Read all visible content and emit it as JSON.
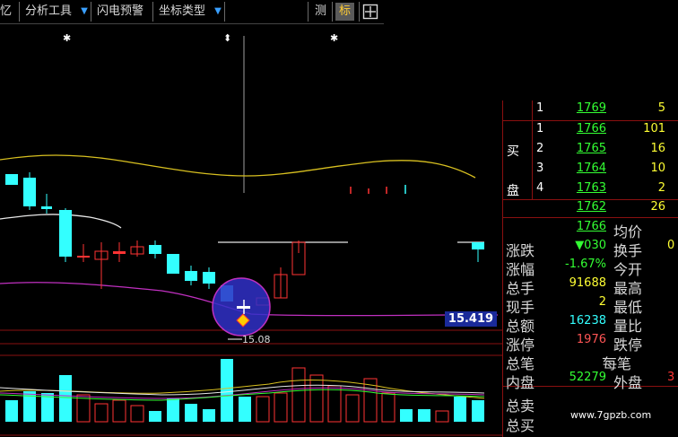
{
  "toolbar": {
    "items": [
      "忆",
      "分析工具",
      "闪电预警",
      "坐标类型",
      "测",
      "标"
    ],
    "grid_icon": "grid-icon",
    "arrow_icon": "dropdown-arrow-icon"
  },
  "chart": {
    "price_tag": "15.419",
    "low_label": "15.08",
    "up_color": "#ff3333",
    "down_color": "#33ffff"
  },
  "quote": {
    "side_buy": "买",
    "side_disk": "盘",
    "levels": [
      {
        "level": "1",
        "price": "1769",
        "vol": "5"
      },
      {
        "level": "1",
        "price": "1766",
        "vol": "101"
      },
      {
        "level": "2",
        "price": "1765",
        "vol": "16"
      },
      {
        "level": "3",
        "price": "1764",
        "vol": "10"
      },
      {
        "level": "4",
        "price": "1763",
        "vol": "2"
      },
      {
        "level": "",
        "price": "1762",
        "vol": "26"
      }
    ],
    "stats": [
      {
        "label": "",
        "value": "1766",
        "label2": "均价",
        "value2": "",
        "color": "#33ff33"
      },
      {
        "label": "涨跌",
        "value": "▼030",
        "label2": "换手",
        "value2": "0",
        "color": "#33ff33"
      },
      {
        "label": "涨幅",
        "value": "-1.67%",
        "label2": "今开",
        "value2": "",
        "color": "#33ff33"
      },
      {
        "label": "总手",
        "value": "91688",
        "label2": "最高",
        "value2": "",
        "color": "#ffff33"
      },
      {
        "label": "现手",
        "value": "2",
        "label2": "最低",
        "value2": "",
        "color": "#ffff33"
      },
      {
        "label": "总额",
        "value": "16238",
        "label2": "量比",
        "value2": "",
        "color": "#33ffff"
      },
      {
        "label": "涨停",
        "value": "1976",
        "label2": "跌停",
        "value2": "",
        "color": "#ff5555"
      },
      {
        "label": "总笔",
        "value": "-",
        "label2": "每笔",
        "value2": "",
        "color": "#d8d8d8"
      },
      {
        "label": "内盘",
        "value": "52279",
        "label2": "外盘",
        "value2": "3",
        "color": "#33ff33"
      },
      {
        "label": "总卖",
        "value": "",
        "label2": "",
        "value2": "",
        "color": "#d8d8d8"
      },
      {
        "label": "总买",
        "value": "",
        "label2": "",
        "value2": "",
        "color": "#d8d8d8"
      }
    ]
  },
  "watermark": "www.7gpzb.com"
}
